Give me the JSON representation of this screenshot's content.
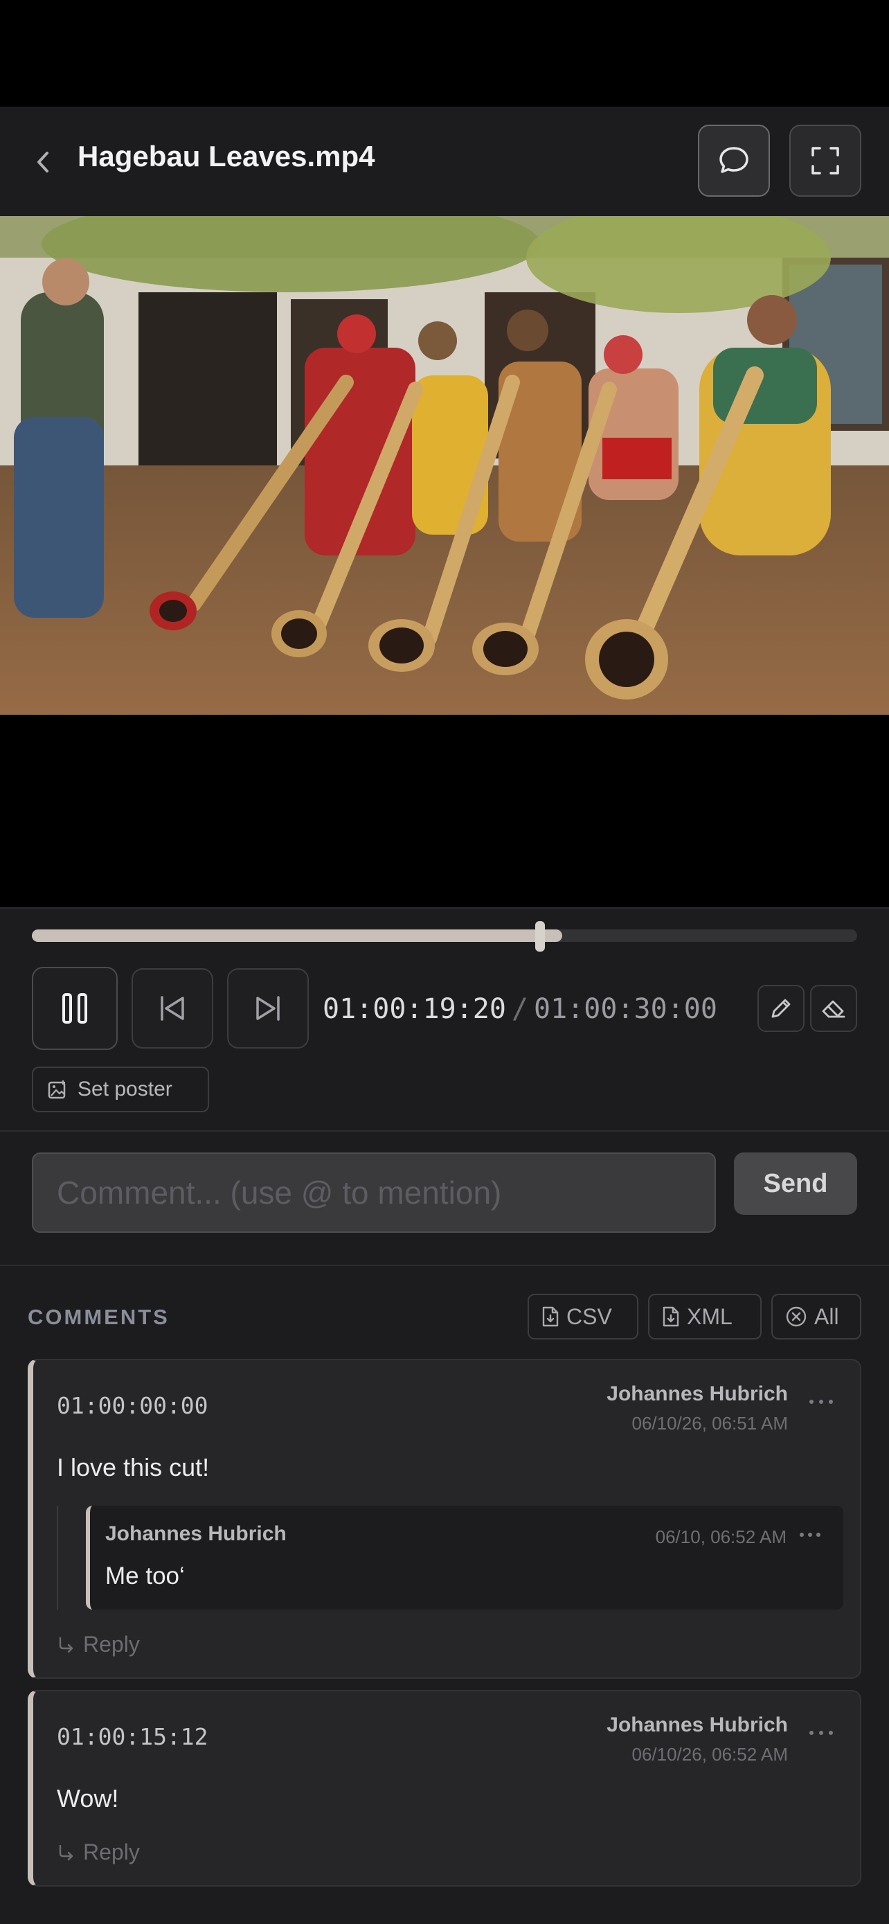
{
  "header": {
    "title": "Hagebau Leaves.mp4"
  },
  "player": {
    "progress_fraction": 0.643,
    "buffered_fraction": 0.61,
    "current_time": "01:00:19:20",
    "separator": "/",
    "duration": "01:00:30:00",
    "poster_label": "Set poster"
  },
  "composer": {
    "placeholder": "Comment... (use @ to mention)",
    "send_label": "Send"
  },
  "comments": {
    "heading": "COMMENTS",
    "export_csv": "CSV",
    "export_xml": "XML",
    "delete_all": "All",
    "items": [
      {
        "timecode": "01:00:00:00",
        "author": "Johannes Hubrich",
        "date": "06/10/26, 06:51 AM",
        "text": "I love this cut!",
        "replies": [
          {
            "author": "Johannes Hubrich",
            "date": "06/10, 06:52 AM",
            "text": "Me too‘"
          }
        ],
        "reply_label": "Reply"
      },
      {
        "timecode": "01:00:15:12",
        "author": "Johannes Hubrich",
        "date": "06/10/26, 06:52 AM",
        "text": "Wow!",
        "reply_label": "Reply"
      }
    ]
  },
  "colors": {
    "accent": "#c8bfb9",
    "background": "#1c1c1e"
  }
}
